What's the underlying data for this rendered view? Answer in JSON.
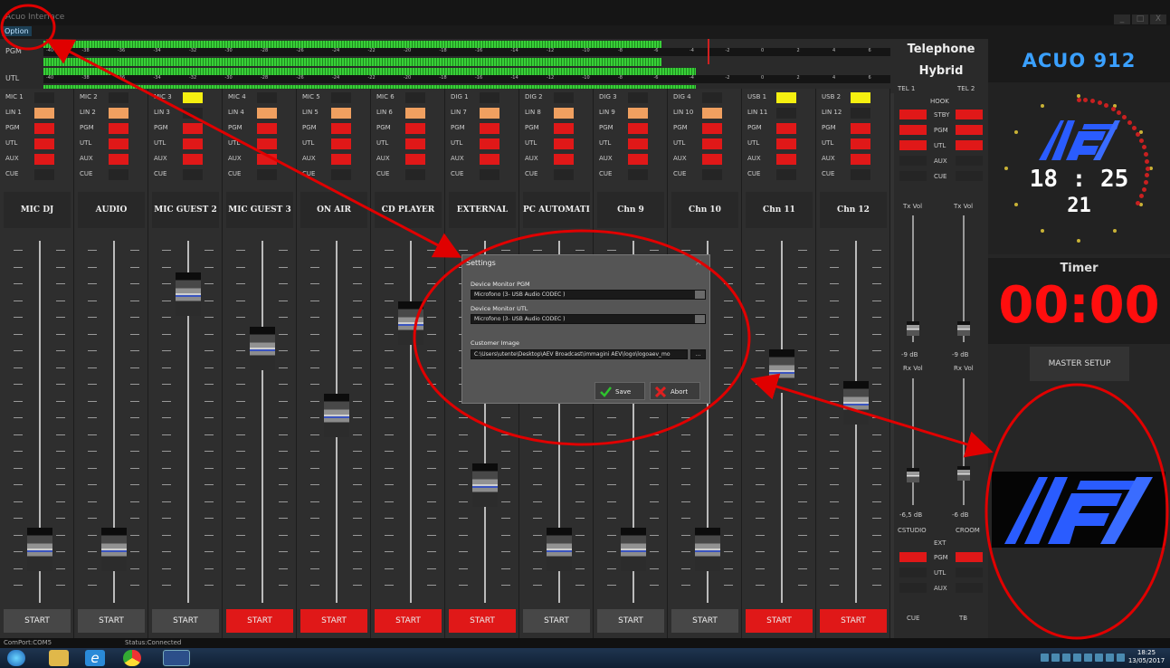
{
  "window": {
    "title": "Acuo Interface",
    "controls": [
      "_",
      "□",
      "X"
    ]
  },
  "menu": {
    "option": "Option"
  },
  "meters": {
    "scale": [
      "-40",
      "-38",
      "-36",
      "-34",
      "-32",
      "-30",
      "-28",
      "-26",
      "-24",
      "-22",
      "-20",
      "-18",
      "-16",
      "-14",
      "-12",
      "-10",
      "-8",
      "-6",
      "-4",
      "-2",
      "0",
      "2",
      "4",
      "6"
    ],
    "rows": [
      {
        "label": "PGM",
        "level": 0.73
      },
      {
        "label": "UTL",
        "level": 0.77
      }
    ]
  },
  "channels": [
    {
      "name": "MIC DJ",
      "routes": [
        {
          "label": "MIC 1",
          "state": "off"
        },
        {
          "label": "LIN 1",
          "state": "orange"
        },
        {
          "label": "PGM",
          "state": "red"
        },
        {
          "label": "UTL",
          "state": "red"
        },
        {
          "label": "AUX",
          "state": "red"
        },
        {
          "label": "CUE",
          "state": "off"
        }
      ],
      "fader": 0.1,
      "start": "START",
      "start_active": false
    },
    {
      "name": "AUDIO",
      "routes": [
        {
          "label": "MIC 2",
          "state": "off"
        },
        {
          "label": "LIN 2",
          "state": "orange"
        },
        {
          "label": "PGM",
          "state": "red"
        },
        {
          "label": "UTL",
          "state": "red"
        },
        {
          "label": "AUX",
          "state": "red"
        },
        {
          "label": "CUE",
          "state": "off"
        }
      ],
      "fader": 0.1,
      "start": "START",
      "start_active": false
    },
    {
      "name": "MIC GUEST 2",
      "routes": [
        {
          "label": "MIC 3",
          "state": "yellow"
        },
        {
          "label": "LIN 3",
          "state": "off"
        },
        {
          "label": "PGM",
          "state": "red"
        },
        {
          "label": "UTL",
          "state": "red"
        },
        {
          "label": "AUX",
          "state": "red"
        },
        {
          "label": "CUE",
          "state": "off"
        }
      ],
      "fader": 0.9,
      "start": "START",
      "start_active": false
    },
    {
      "name": "MIC GUEST 3",
      "routes": [
        {
          "label": "MIC 4",
          "state": "off"
        },
        {
          "label": "LIN 4",
          "state": "orange"
        },
        {
          "label": "PGM",
          "state": "red"
        },
        {
          "label": "UTL",
          "state": "red"
        },
        {
          "label": "AUX",
          "state": "red"
        },
        {
          "label": "CUE",
          "state": "off"
        }
      ],
      "fader": 0.73,
      "start": "START",
      "start_active": true
    },
    {
      "name": "ON AIR",
      "routes": [
        {
          "label": "MIC 5",
          "state": "off"
        },
        {
          "label": "LIN 5",
          "state": "orange"
        },
        {
          "label": "PGM",
          "state": "red"
        },
        {
          "label": "UTL",
          "state": "red"
        },
        {
          "label": "AUX",
          "state": "red"
        },
        {
          "label": "CUE",
          "state": "off"
        }
      ],
      "fader": 0.52,
      "start": "START",
      "start_active": true
    },
    {
      "name": "CD PLAYER",
      "routes": [
        {
          "label": "MIC 6",
          "state": "off"
        },
        {
          "label": "LIN 6",
          "state": "orange"
        },
        {
          "label": "PGM",
          "state": "red"
        },
        {
          "label": "UTL",
          "state": "red"
        },
        {
          "label": "AUX",
          "state": "red"
        },
        {
          "label": "CUE",
          "state": "off"
        }
      ],
      "fader": 0.81,
      "start": "START",
      "start_active": true
    },
    {
      "name": "EXTERNAL",
      "routes": [
        {
          "label": "DIG 1",
          "state": "off"
        },
        {
          "label": "LIN 7",
          "state": "orange"
        },
        {
          "label": "PGM",
          "state": "red"
        },
        {
          "label": "UTL",
          "state": "red"
        },
        {
          "label": "AUX",
          "state": "red"
        },
        {
          "label": "CUE",
          "state": "off"
        }
      ],
      "fader": 0.3,
      "start": "START",
      "start_active": true
    },
    {
      "name": "PC AUTOMATION",
      "routes": [
        {
          "label": "DIG 2",
          "state": "off"
        },
        {
          "label": "LIN 8",
          "state": "orange"
        },
        {
          "label": "PGM",
          "state": "red"
        },
        {
          "label": "UTL",
          "state": "red"
        },
        {
          "label": "AUX",
          "state": "red"
        },
        {
          "label": "CUE",
          "state": "off"
        }
      ],
      "fader": 0.1,
      "start": "START",
      "start_active": false
    },
    {
      "name": "Chn 9",
      "routes": [
        {
          "label": "DIG 3",
          "state": "off"
        },
        {
          "label": "LIN 9",
          "state": "orange"
        },
        {
          "label": "PGM",
          "state": "red"
        },
        {
          "label": "UTL",
          "state": "red"
        },
        {
          "label": "AUX",
          "state": "red"
        },
        {
          "label": "CUE",
          "state": "off"
        }
      ],
      "fader": 0.1,
      "start": "START",
      "start_active": false
    },
    {
      "name": "Chn 10",
      "routes": [
        {
          "label": "DIG 4",
          "state": "off"
        },
        {
          "label": "LIN 10",
          "state": "orange"
        },
        {
          "label": "PGM",
          "state": "red"
        },
        {
          "label": "UTL",
          "state": "red"
        },
        {
          "label": "AUX",
          "state": "red"
        },
        {
          "label": "CUE",
          "state": "off"
        }
      ],
      "fader": 0.1,
      "start": "START",
      "start_active": false
    },
    {
      "name": "Chn 11",
      "routes": [
        {
          "label": "USB 1",
          "state": "yellow"
        },
        {
          "label": "LIN 11",
          "state": "off"
        },
        {
          "label": "PGM",
          "state": "red"
        },
        {
          "label": "UTL",
          "state": "red"
        },
        {
          "label": "AUX",
          "state": "red"
        },
        {
          "label": "CUE",
          "state": "off"
        }
      ],
      "fader": 0.66,
      "start": "START",
      "start_active": true
    },
    {
      "name": "Chn 12",
      "routes": [
        {
          "label": "USB 2",
          "state": "yellow"
        },
        {
          "label": "LIN 12",
          "state": "off"
        },
        {
          "label": "PGM",
          "state": "red"
        },
        {
          "label": "UTL",
          "state": "red"
        },
        {
          "label": "AUX",
          "state": "red"
        },
        {
          "label": "CUE",
          "state": "off"
        }
      ],
      "fader": 0.56,
      "start": "START",
      "start_active": true
    }
  ],
  "telephone": {
    "title_line1": "Telephone",
    "title_line2": "Hybrid",
    "tel1": "TEL 1",
    "tel2": "TEL 2",
    "hook": "HOOK",
    "rows": [
      {
        "label": "STBY",
        "l": "red",
        "r": "red"
      },
      {
        "label": "PGM",
        "l": "red",
        "r": "red"
      },
      {
        "label": "UTL",
        "l": "red",
        "r": "red"
      },
      {
        "label": "AUX",
        "l": "off",
        "r": "off"
      },
      {
        "label": "CUE",
        "l": "off",
        "r": "off"
      }
    ],
    "tx_vol": "Tx Vol",
    "rx_vol": "Rx Vol",
    "tx_left_db": "-9 dB",
    "tx_right_db": "-9 dB",
    "rx_left_db": "-6,5 dB",
    "rx_right_db": "-6 dB",
    "studio": "CSTUDIO",
    "croom": "CROOM",
    "ext": "EXT",
    "bottom_rows": [
      {
        "label": "PGM",
        "l": "red",
        "r": "red"
      },
      {
        "label": "UTL",
        "l": "off",
        "r": "off"
      },
      {
        "label": "AUX",
        "l": "off",
        "r": "off"
      }
    ],
    "cue": "CUE",
    "tb": "TB"
  },
  "right_panel": {
    "brand": "ACUO 912",
    "clock_time": "18 : 25",
    "clock_seconds": "21",
    "timer_label": "Timer",
    "timer_value": "00:00",
    "master_setup": "MASTER SETUP"
  },
  "settings_dialog": {
    "title": "Settings",
    "close": "×",
    "pgm_label": "Device Monitor PGM",
    "pgm_value": "Microfono (3- USB Audio CODEC )",
    "utl_label": "Device Monitor UTL",
    "utl_value": "Microfono (3- USB Audio CODEC )",
    "image_label": "Customer Image",
    "image_value": "C:\\Users\\utente\\Desktop\\AEV Broadcast\\immagini AEV\\logo\\logoaev_mo",
    "browse": "...",
    "save": "Save",
    "abort": "Abort"
  },
  "status_bar": {
    "comport": "ComPort:COM5",
    "status": "Status:Connected"
  },
  "taskbar": {
    "time": "18:25",
    "date": "13/05/2017"
  },
  "colors": {
    "on_red": "#e01818",
    "orange": "#f0a060",
    "yellow": "#f5f010",
    "meter_green": "#38d038",
    "brand_blue": "#3aa0ff",
    "timer_red": "#ff0e0e",
    "annotation_red": "#e00000"
  }
}
